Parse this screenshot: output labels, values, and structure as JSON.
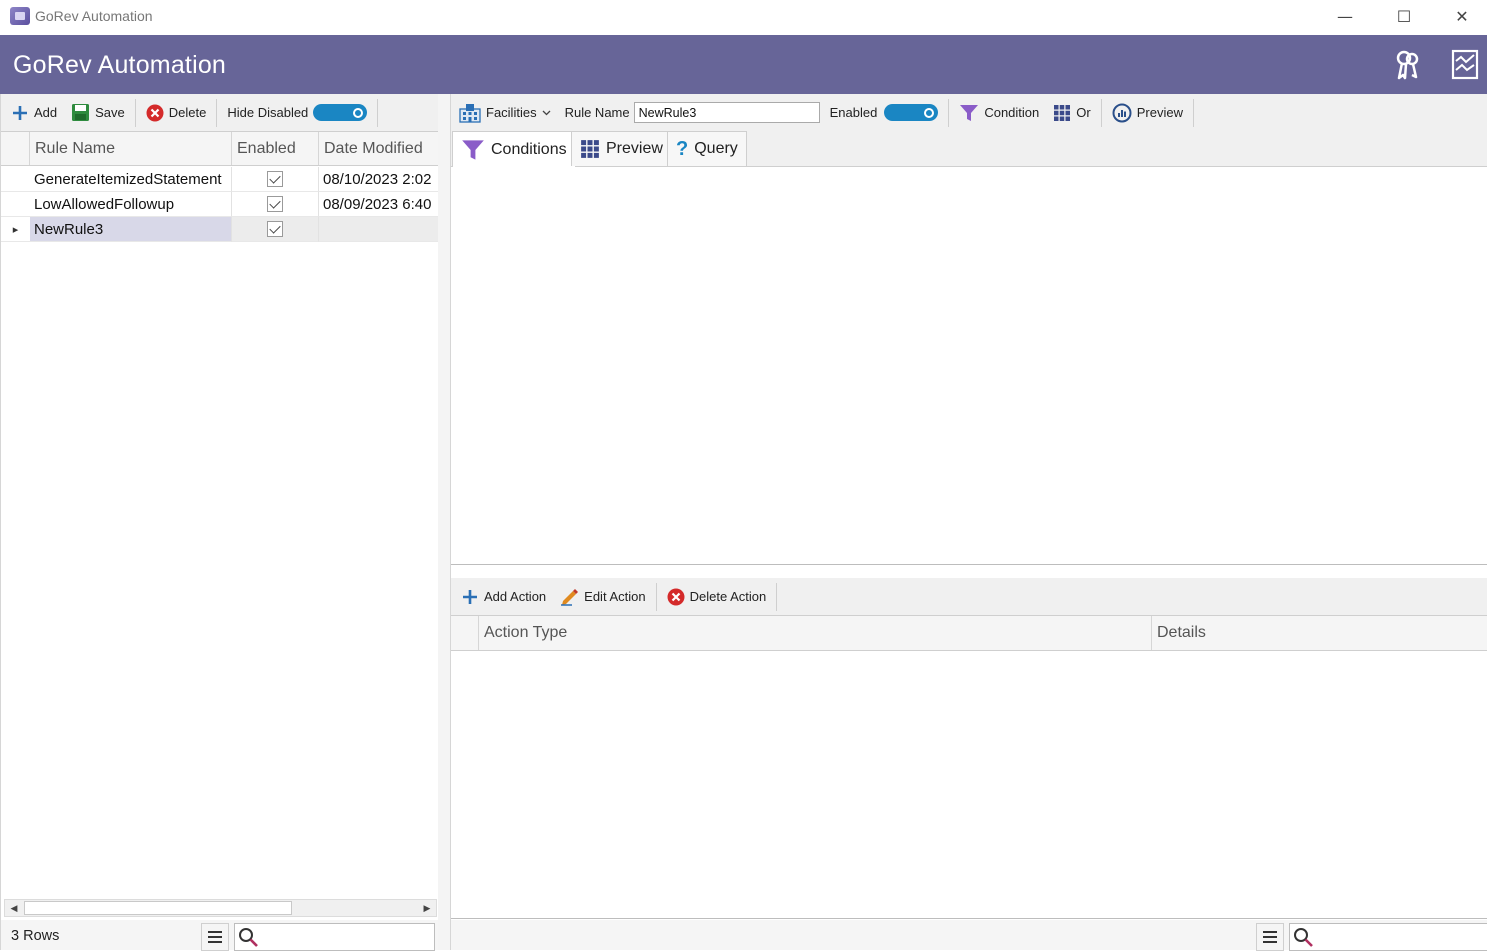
{
  "window": {
    "title": "GoRev Automation",
    "minimize_glyph": "—",
    "maximize_glyph": "☐",
    "close_glyph": "✕"
  },
  "header": {
    "title": "GoRev Automation",
    "icons": [
      "keys-icon",
      "report-chart-icon"
    ]
  },
  "left_toolbar": {
    "add_label": "Add",
    "save_label": "Save",
    "delete_label": "Delete",
    "hide_disabled_label": "Hide Disabled",
    "hide_disabled_on": true
  },
  "rules_grid": {
    "columns": [
      "Rule Name",
      "Enabled",
      "Date Modified"
    ],
    "rows": [
      {
        "name": "GenerateItemizedStatement",
        "enabled": true,
        "modified": "08/10/2023 2:02"
      },
      {
        "name": "LowAllowedFollowup",
        "enabled": true,
        "modified": "08/09/2023 6:40"
      },
      {
        "name": "NewRule3",
        "enabled": true,
        "modified": "",
        "selected": true
      }
    ],
    "row_indicator": "▸"
  },
  "left_status": {
    "rows_text": "3 Rows",
    "search_value": ""
  },
  "right_toolbar": {
    "facilities_label": "Facilities",
    "rule_name_label": "Rule Name",
    "rule_name_value": "NewRule3",
    "enabled_label": "Enabled",
    "enabled_on": true,
    "condition_label": "Condition",
    "or_label": "Or",
    "preview_label": "Preview"
  },
  "tabs": [
    {
      "label": "Conditions",
      "active": true
    },
    {
      "label": "Preview",
      "active": false
    },
    {
      "label": "Query",
      "active": false
    }
  ],
  "actions_toolbar": {
    "add_label": "Add Action",
    "edit_label": "Edit Action",
    "delete_label": "Delete Action"
  },
  "actions_grid": {
    "columns": [
      "Action Type",
      "Details"
    ]
  },
  "right_status": {
    "search_value": ""
  },
  "colors": {
    "header_bg": "#676598",
    "toggle_on": "#1a86c3",
    "selected_row": "#d8d8e8",
    "delete_red": "#d42a2a",
    "add_blue": "#2a6fb5",
    "save_green": "#2e8b3e",
    "filter_purple": "#8a5cc8"
  }
}
